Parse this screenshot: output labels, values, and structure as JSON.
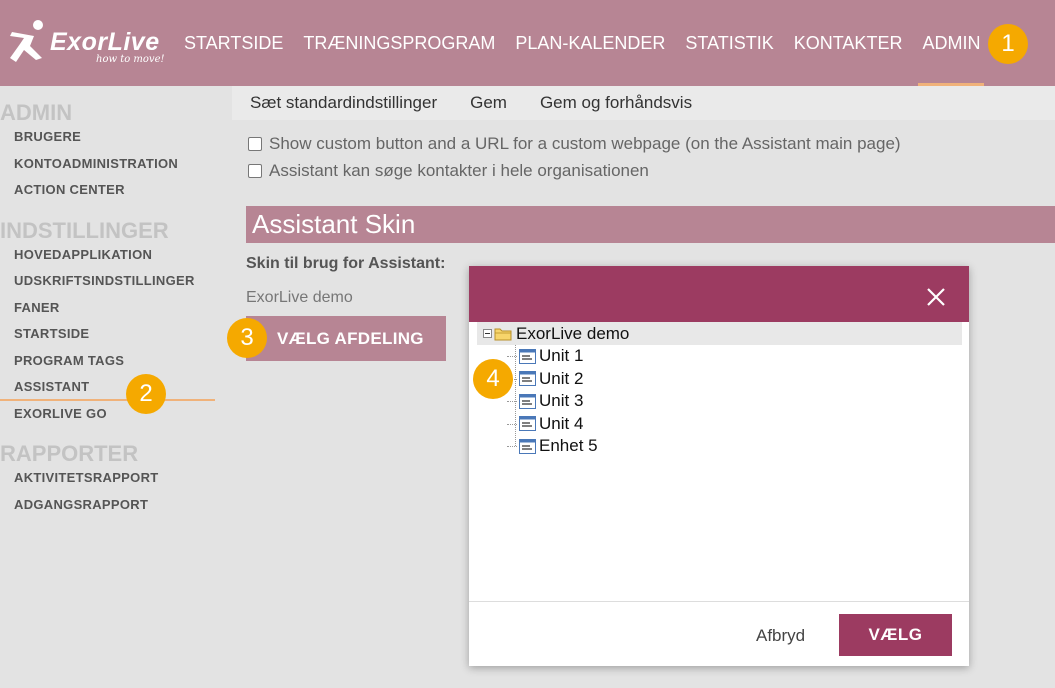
{
  "app": {
    "brand": "ExorLive",
    "slogan": "how to move!"
  },
  "nav": {
    "items": [
      "STARTSIDE",
      "TRÆNINGSPROGRAM",
      "PLAN-KALENDER",
      "STATISTIK",
      "KONTAKTER",
      "ADMIN"
    ],
    "active": "ADMIN"
  },
  "badges": [
    "1",
    "2",
    "3",
    "4"
  ],
  "sidebar": {
    "admin_title": "ADMIN",
    "admin_items": [
      "BRUGERE",
      "KONTOADMINISTRATION",
      "ACTION CENTER"
    ],
    "settings_title": "INDSTILLINGER",
    "settings_items": [
      "HOVEDAPPLIKATION",
      "UDSKRIFTSINDSTILLINGER",
      "FANER",
      "STARTSIDE",
      "PROGRAM TAGS",
      "ASSISTANT",
      "EXORLIVE GO"
    ],
    "reports_title": "RAPPORTER",
    "reports_items": [
      "AKTIVITETSRAPPORT",
      "ADGANGSRAPPORT"
    ]
  },
  "toolbar": {
    "set_defaults": "Sæt standardindstillinger",
    "save": "Gem",
    "save_preview": "Gem og forhåndsvis"
  },
  "options": {
    "custom_button": "Show custom button and a URL for a custom webpage (on the Assistant main page)",
    "search_contacts": "Assistant kan søge kontakter i hele organisationen"
  },
  "skin": {
    "header": "Assistant Skin",
    "label": "Skin til brug for Assistant:",
    "value": "ExorLive demo",
    "choose_button": "VÆLG AFDELING"
  },
  "dialog": {
    "root": "ExorLive demo",
    "units": [
      "Unit 1",
      "Unit 2",
      "Unit 3",
      "Unit 4",
      "Enhet 5"
    ],
    "cancel": "Afbryd",
    "ok": "VÆLG"
  },
  "colors": {
    "topbar": "#b78594",
    "dialog_accent": "#9c3b61",
    "badge": "#f5a900",
    "underline": "#f0b27a"
  }
}
